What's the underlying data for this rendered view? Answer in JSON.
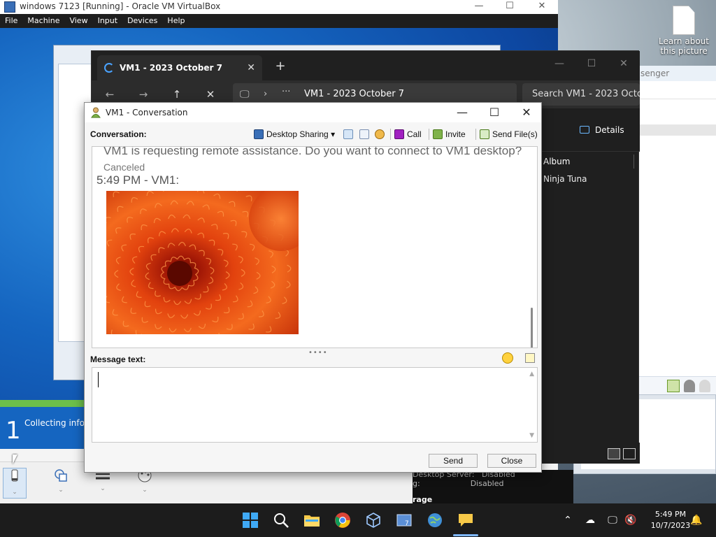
{
  "desktop": {
    "icon_label": "Learn about this picture"
  },
  "vbox": {
    "title": "windows 7123 [Running] - Oracle VM VirtualBox",
    "menu": [
      "File",
      "Machine",
      "View",
      "Input",
      "Devices",
      "Help"
    ]
  },
  "guest": {
    "progress_step": "1",
    "progress_text": "Collecting infor"
  },
  "messenger_back": {
    "title_fragment": "senger"
  },
  "explorer": {
    "tab_title": "VM1 - 2023 October 7",
    "address_path": "VM1 - 2023 October 7",
    "search_placeholder": "Search VM1 - 2023 Octo",
    "details_label": "Details",
    "column_header": "Album",
    "cell_value": "Ninja Tuna"
  },
  "sysinfo": {
    "row1_label": "Desktop Server:",
    "row1_value": "Disabled",
    "row2_label": "g:",
    "row2_value": "Disabled",
    "row3": "rage"
  },
  "conversation": {
    "window_title": "VM1 - Conversation",
    "conversation_label": "Conversation:",
    "toolbar": {
      "desktop_sharing": "Desktop Sharing",
      "call": "Call",
      "invite": "Invite",
      "send_files": "Send File(s)"
    },
    "history": {
      "request_text": "VM1 is requesting remote assistance. Do you want to connect to VM1 desktop?",
      "request_status": "Canceled",
      "timestamp": "5:49 PM - VM1:"
    },
    "message_label": "Message text:",
    "message_value": "",
    "send_label": "Send",
    "close_label": "Close"
  },
  "taskbar": {
    "time": "5:49 PM",
    "date": "10/7/2023"
  }
}
